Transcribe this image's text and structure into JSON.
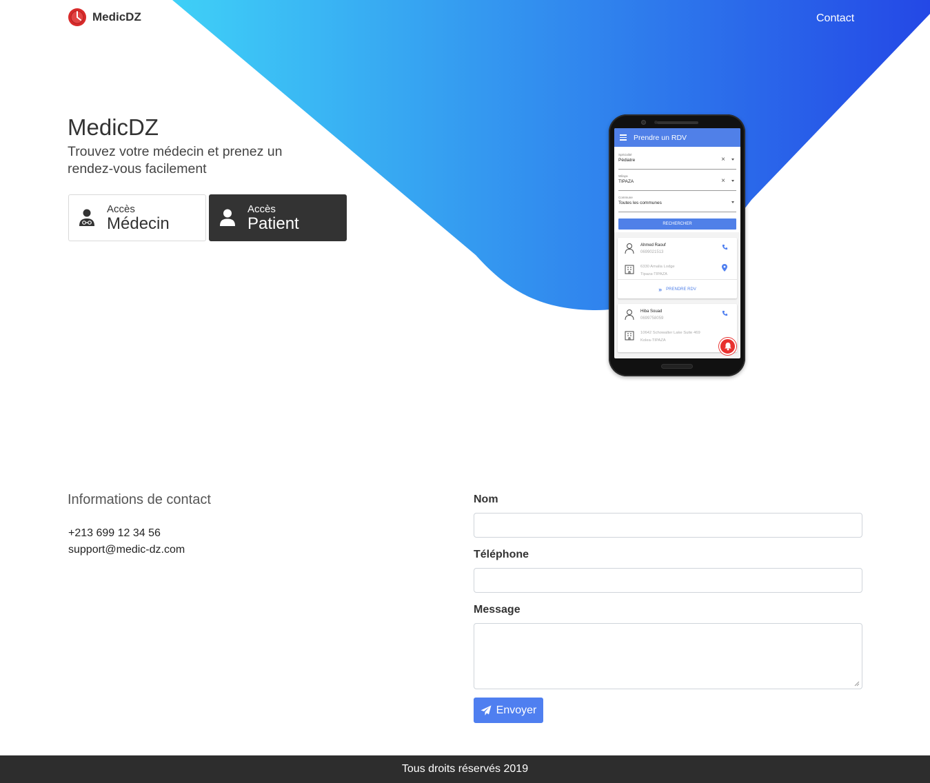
{
  "navbar": {
    "brand": "MedicDZ",
    "contact_link": "Contact"
  },
  "hero": {
    "title": "MedicDZ",
    "subtitle": "Trouvez votre médecin et prenez un rendez-vous facilement",
    "buttons": [
      {
        "small": "Accès",
        "big": "Médecin",
        "icon": "doctor-icon"
      },
      {
        "small": "Accès",
        "big": "Patient",
        "icon": "user-icon"
      }
    ]
  },
  "phone_app": {
    "app_bar_title": "Prendre un RDV",
    "fields": [
      {
        "label": "Spécialité",
        "value": "Pédiatre"
      },
      {
        "label": "Wilaya",
        "value": "TIPAZA"
      },
      {
        "label": "Commune",
        "value": "Toutes les communes"
      }
    ],
    "search_button": "RECHERCHER",
    "doctors": [
      {
        "name": "Ahmed Raouf",
        "phone": "0699021513",
        "address": "6330 Amalia Lodge",
        "city": "Tipaza-TIPAZA",
        "action": "PRENDRE RDV"
      },
      {
        "name": "Hiba Souad",
        "phone": "0699758059",
        "address": "10642 Schowalter Lake Suite 469",
        "city": "Kolea-TIPAZA"
      }
    ]
  },
  "contact": {
    "title": "Informations de contact",
    "phone": "+213 699 12 34 56",
    "email": "support@medic-dz.com"
  },
  "form": {
    "name_label": "Nom",
    "name_value": "",
    "phone_label": "Téléphone",
    "phone_value": "",
    "message_label": "Message",
    "message_value": "",
    "submit_label": "Envoyer"
  },
  "footer": {
    "text": "Tous droits réservés 2019"
  },
  "colors": {
    "gradient_start": "#3fd0f7",
    "gradient_end": "#2448e6",
    "accent": "#4f7ff0",
    "dark_button": "#333333",
    "footer": "#2d2d2d"
  }
}
